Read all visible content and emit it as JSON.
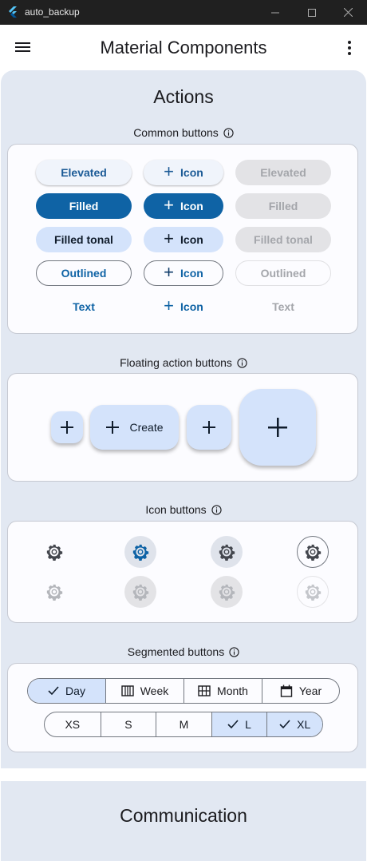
{
  "window": {
    "title": "auto_backup"
  },
  "appbar": {
    "title": "Material Components"
  },
  "actions_heading": "Actions",
  "communication_heading": "Communication",
  "common_buttons": {
    "title": "Common buttons",
    "rows": [
      [
        "Elevated",
        "Icon",
        "Elevated"
      ],
      [
        "Filled",
        "Icon",
        "Filled"
      ],
      [
        "Filled tonal",
        "Icon",
        "Filled tonal"
      ],
      [
        "Outlined",
        "Icon",
        "Outlined"
      ],
      [
        "Text",
        "Icon",
        "Text"
      ]
    ]
  },
  "fab": {
    "title": "Floating action buttons",
    "extended_label": "Create"
  },
  "icon_buttons": {
    "title": "Icon buttons"
  },
  "segmented": {
    "title": "Segmented buttons",
    "calendar": [
      {
        "label": "Day",
        "selected": true,
        "icon": "check-icon"
      },
      {
        "label": "Week",
        "selected": false,
        "icon": "week-view-icon"
      },
      {
        "label": "Month",
        "selected": false,
        "icon": "month-view-icon"
      },
      {
        "label": "Year",
        "selected": false,
        "icon": "calendar-icon"
      }
    ],
    "sizes": [
      {
        "label": "XS",
        "selected": false
      },
      {
        "label": "S",
        "selected": false
      },
      {
        "label": "M",
        "selected": false
      },
      {
        "label": "L",
        "selected": true
      },
      {
        "label": "XL",
        "selected": true
      }
    ]
  },
  "colors": {
    "primary": "#0f63a5",
    "tonal": "#d4e3fb",
    "surface": "#e2e8f2",
    "titlebar": "#202020"
  }
}
